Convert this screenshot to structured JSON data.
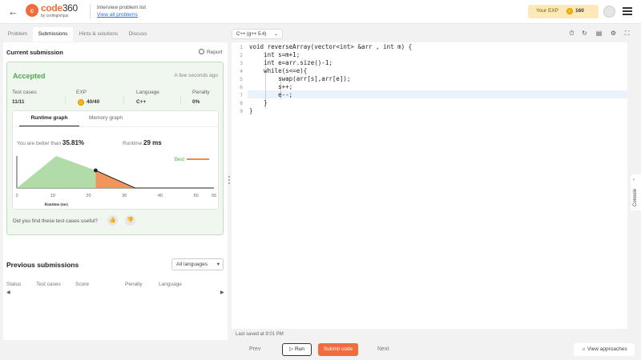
{
  "header": {
    "brand": "code",
    "brand_num": "360",
    "brand_sub": "by codingninjas",
    "problem_list_label": "Interview problem list",
    "view_all_link": "View all problems",
    "exp_label": "Your EXP",
    "exp_value": "160"
  },
  "tabs": [
    "Problem",
    "Submissions",
    "Hints & solutions",
    "Discuss"
  ],
  "current_submission": {
    "title": "Current submission",
    "report_label": "Report",
    "status": "Accepted",
    "time_ago": "A few seconds ago",
    "stats": [
      {
        "label": "Test cases",
        "value": "11/11"
      },
      {
        "label": "EXP",
        "value": "40/40"
      },
      {
        "label": "Language",
        "value": "C++"
      },
      {
        "label": "Penalty",
        "value": "0%"
      }
    ],
    "graph_tabs": [
      "Runtime graph",
      "Memory graph"
    ],
    "better_than_label": "You are better than",
    "better_than_value": "35.81%",
    "runtime_label": "Runtime",
    "runtime_value": "29 ms",
    "useful_question": "Did you find these test cases useful?"
  },
  "chart_data": {
    "type": "area",
    "xlabel": "Runtime (ms)",
    "x_ticks": [
      "0",
      "10",
      "20",
      "30",
      "40",
      "50",
      "55"
    ],
    "xlim": [
      0,
      55
    ],
    "x": [
      0,
      11,
      22,
      33,
      55
    ],
    "y": [
      0,
      1.0,
      0.55,
      0,
      0
    ],
    "marker_x": 22,
    "legend": "Best",
    "colors": {
      "early": "#a9d8a0",
      "late": "#f08a4b",
      "marker": "#222222"
    }
  },
  "previous_submissions": {
    "title": "Previous submissions",
    "filter_label": "All languages",
    "columns": [
      "Status",
      "Test cases",
      "Score",
      "Penalty",
      "Language"
    ]
  },
  "editor": {
    "language": "C++ (g++ 5.4)",
    "code_lines": [
      "void reverseArray(vector<int> &arr , int m) {",
      "    int s=m+1;",
      "    int e=arr.size()-1;",
      "    while(s<=e){",
      "        swap(arr[s],arr[e]);",
      "        s++;",
      "        e--;",
      "    }",
      "}"
    ],
    "line_numbers": [
      "1",
      "2",
      "3",
      "4",
      "5",
      "6",
      "7",
      "8",
      "9"
    ],
    "last_saved": "Last saved at 9:01 PM",
    "console_label": "Console"
  },
  "footer": {
    "prev": "Prev",
    "run": "Run",
    "submit": "Submit code",
    "next": "Next",
    "view_approaches": "View approaches"
  },
  "colors": {
    "accent": "#f26b3a",
    "success": "#4caa4c",
    "link": "#2a6fdb"
  }
}
